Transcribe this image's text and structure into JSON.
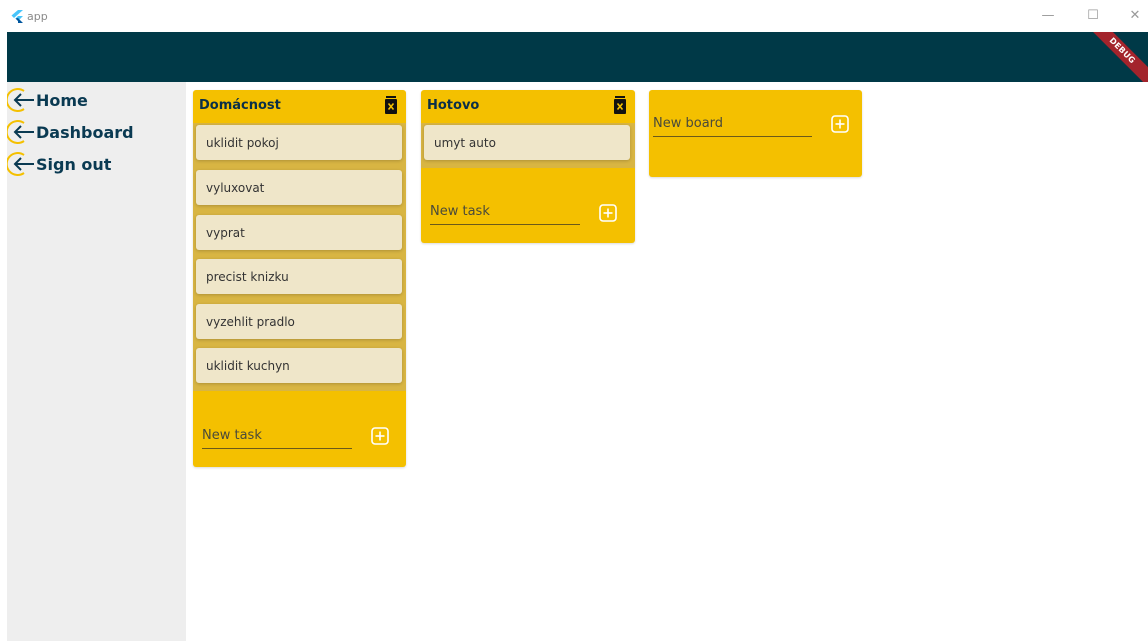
{
  "window": {
    "title": "app",
    "minimize_glyph": "—",
    "maximize_glyph": "☐",
    "close_glyph": "✕"
  },
  "appbar": {
    "color": "#003947",
    "debug_label": "DEBUG"
  },
  "sidebar": {
    "items": [
      {
        "label": "Home",
        "icon": "arrow-left-circle-icon"
      },
      {
        "label": "Dashboard",
        "icon": "arrow-left-circle-icon"
      },
      {
        "label": "Sign out",
        "icon": "arrow-left-circle-icon"
      }
    ]
  },
  "boards": [
    {
      "title": "Domácnost",
      "tasks": [
        "uklidit pokoj",
        "vyluxovat",
        "vyprat",
        "precist knizku",
        "vyzehlit pradlo",
        "uklidit kuchyn"
      ],
      "new_task_placeholder": "New task"
    },
    {
      "title": "Hotovo",
      "tasks": [
        "umyt auto"
      ],
      "new_task_placeholder": "New task"
    }
  ],
  "new_board": {
    "placeholder": "New board"
  },
  "colors": {
    "board": "#f4c000",
    "task": "#efe6c9",
    "sidebar": "#eeeeee",
    "nav_text": "#0a3a52",
    "icon_accent": "#f4c000"
  }
}
